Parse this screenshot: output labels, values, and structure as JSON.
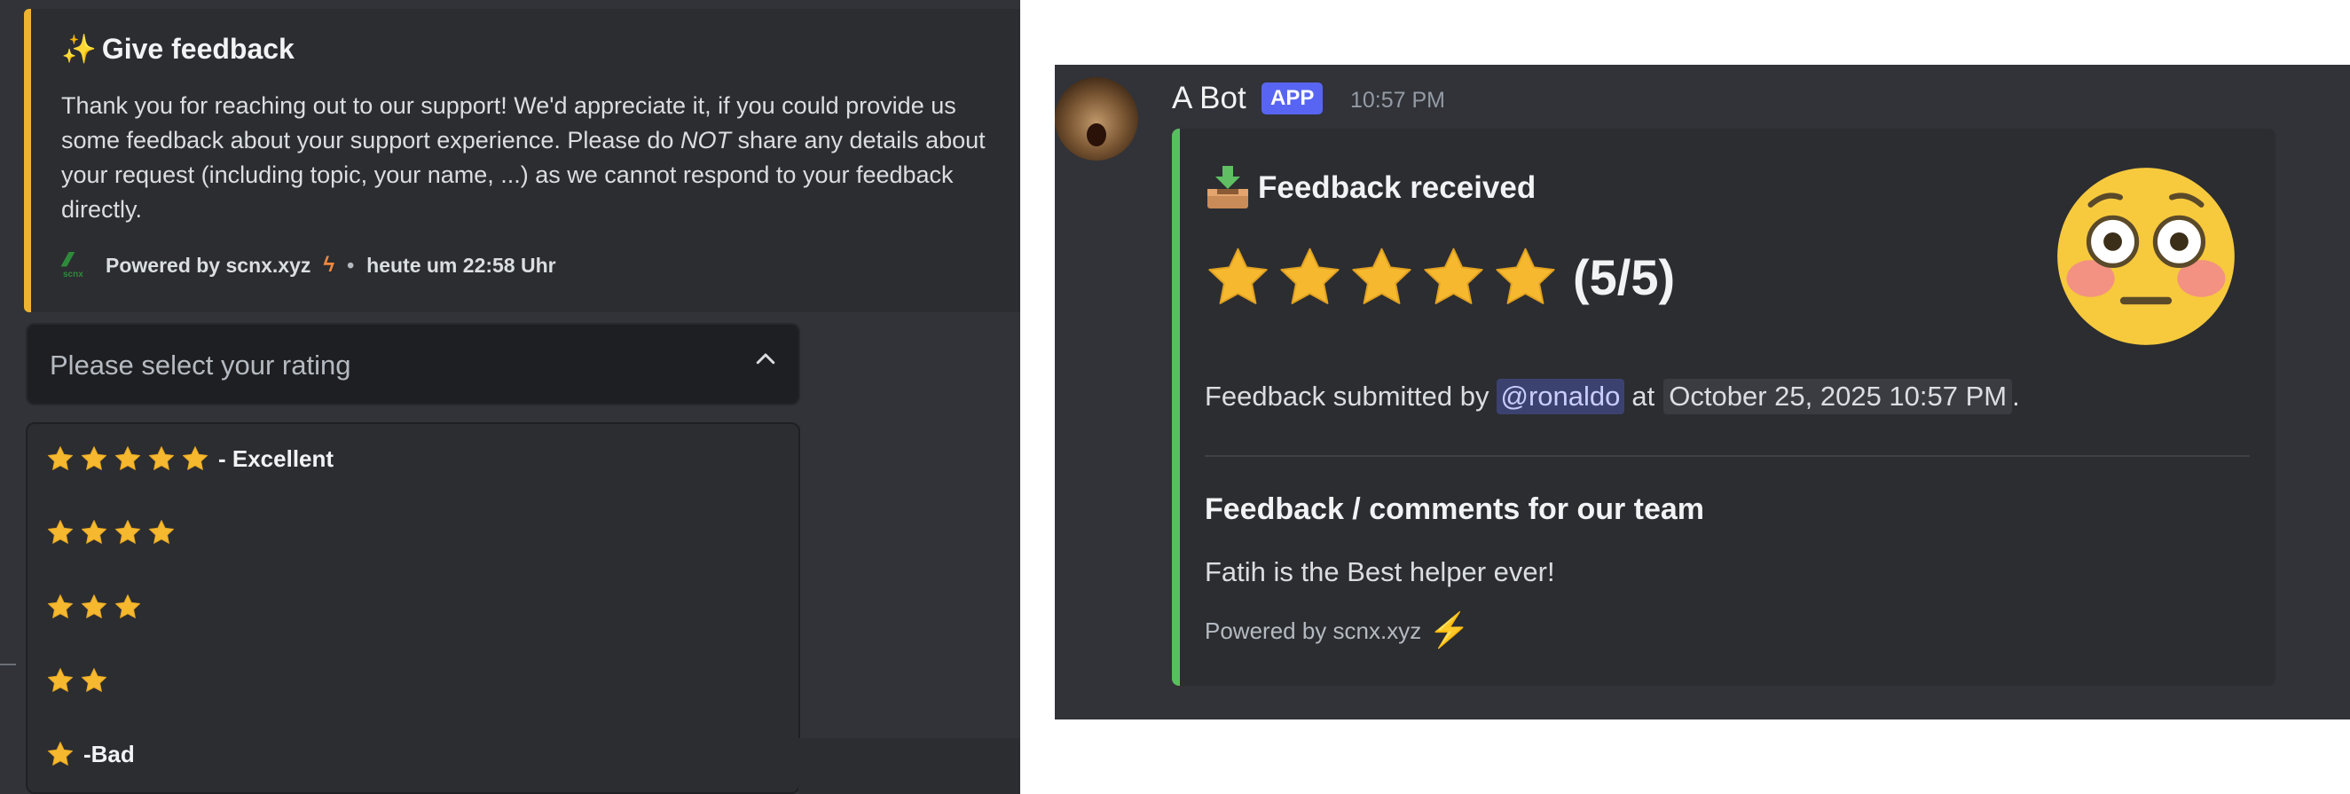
{
  "left": {
    "embed": {
      "title_icon": "sparkles-icon",
      "title": "Give feedback",
      "desc_1": "Thank you for reaching out to our support! We'd appreciate it, if you could provide us some feedback about your support experience. Please do ",
      "desc_em": "NOT",
      "desc_2": " share any details about your request (including topic, your name, ...) as we cannot respond to your feedback directly.",
      "footer_text": "Powered by scnx.xyz",
      "footer_logo_text": "scnx",
      "footer_time": "heute um 22:58 Uhr",
      "accent_color": "#f0b232"
    },
    "select": {
      "placeholder": "Please select your rating"
    },
    "options": [
      {
        "stars": 5,
        "label": "- Excellent"
      },
      {
        "stars": 4,
        "label": ""
      },
      {
        "stars": 3,
        "label": ""
      },
      {
        "stars": 2,
        "label": ""
      },
      {
        "stars": 1,
        "label": "-Bad"
      }
    ]
  },
  "right": {
    "author": "A Bot",
    "badge": "APP",
    "time": "10:57 PM",
    "embed": {
      "accent_color": "#57c05e",
      "title_icon": "inbox-tray-icon",
      "title": "Feedback received",
      "rating": 5,
      "score_text": "(5/5)",
      "thumbnail_icon": "flushed-face-icon",
      "submitted_prefix": "Feedback submitted by",
      "mention": "@ronaldo",
      "at_text": "at",
      "timestamp": "October 25, 2025 10:57 PM",
      "period": ".",
      "field_name": "Feedback / comments for our team",
      "field_value": "Fatih is the Best helper ever!",
      "footer": "Powered by scnx.xyz"
    }
  }
}
